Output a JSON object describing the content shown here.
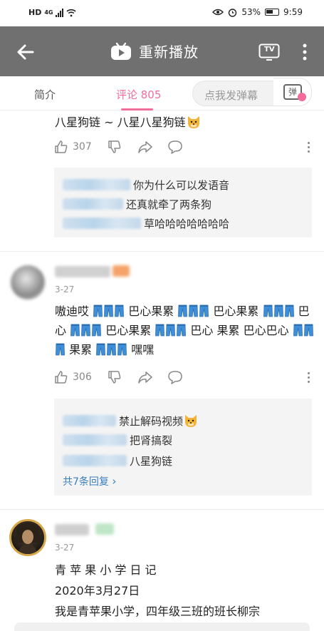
{
  "status_bar": {
    "left_label": "HD",
    "net_label": "4G",
    "battery_percent": "53%",
    "time": "9:59"
  },
  "toolbar": {
    "title": "重新播放",
    "tv_label": "TV"
  },
  "tabs": {
    "intro": "简介",
    "comments": "评论 805",
    "danmaku_placeholder": "点我发弹幕",
    "danmaku_button": "弹"
  },
  "comment1": {
    "text_tail": "八星狗链 ~ 八星八星狗链",
    "likes": "307",
    "replies": [
      {
        "text": "你为什么可以发语音"
      },
      {
        "text": "还真就牵了两条狗"
      },
      {
        "text": "草哈哈哈哈哈哈哈"
      }
    ]
  },
  "comment2": {
    "date": "3-27",
    "segments": [
      "嗷迪哎",
      "巴心果累",
      "巴心果累",
      "巴心",
      "巴心果累",
      "巴心",
      "果累 巴心巴心",
      "果累",
      "嘿嘿"
    ],
    "likes": "306",
    "replies": [
      {
        "text": "禁止解码视频"
      },
      {
        "text": "把肾搞裂"
      },
      {
        "text": "八星狗链"
      }
    ],
    "more_replies": "共7条回复"
  },
  "comment3": {
    "date": "3-27",
    "lines": [
      "青 苹 果 小 学 日 记",
      "2020年3月27日",
      "我是青苹果小学，四年级三班的班长柳宗"
    ]
  },
  "colors": {
    "accent": "#f26d99",
    "toolbar": "#707070",
    "link": "#3a7fc1"
  }
}
